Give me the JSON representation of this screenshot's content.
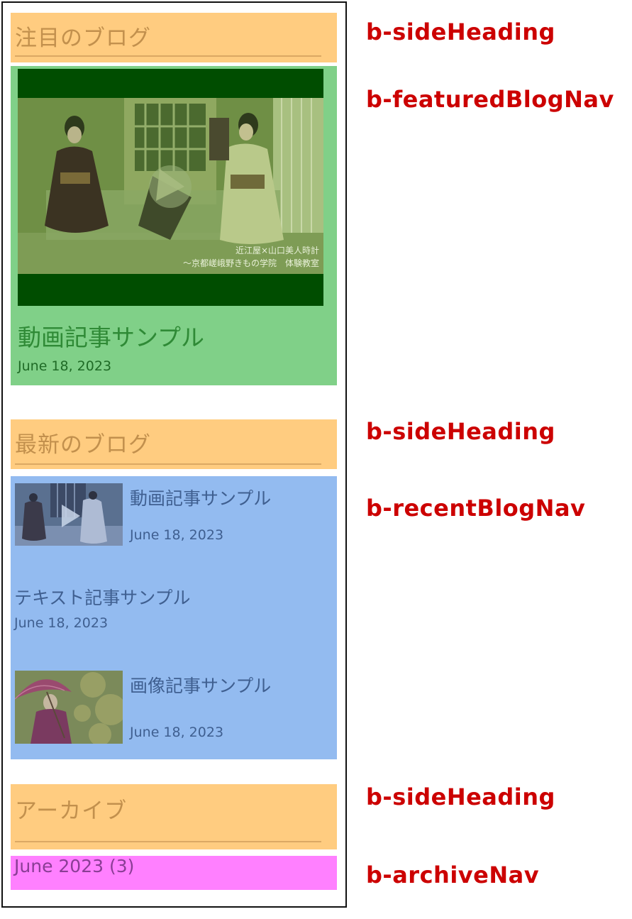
{
  "headings": {
    "featured": "注目のブログ",
    "recent": "最新のブログ",
    "archive": "アーカイブ"
  },
  "featured": {
    "title": "動画記事サンプル",
    "date": "June 18, 2023",
    "caption_line1": "近江屋×山口美人時計",
    "caption_line2": "〜京都嵯峨野きもの学院　体験教室"
  },
  "recent": {
    "items": [
      {
        "title": "動画記事サンプル",
        "date": "June 18, 2023"
      },
      {
        "title": "テキスト記事サンプル",
        "date": "June 18, 2023"
      },
      {
        "title": "画像記事サンプル",
        "date": "June 18, 2023"
      }
    ]
  },
  "archive": {
    "items": [
      {
        "label": "June 2023 (3)"
      }
    ]
  },
  "annotations": {
    "heading_1": "b-sideHeading",
    "featured_nav": "b-featuredBlogNav",
    "heading_2": "b-sideHeading",
    "recent_nav": "b-recentBlogNav",
    "heading_3": "b-sideHeading",
    "archive_nav": "b-archiveNav"
  },
  "colors": {
    "side_heading_bg": "#ffcc80",
    "featured_bg": "#80d088",
    "recent_bg": "#93bbf0",
    "archive_bg": "#ff80ff",
    "annotation_text": "#cc0000"
  }
}
